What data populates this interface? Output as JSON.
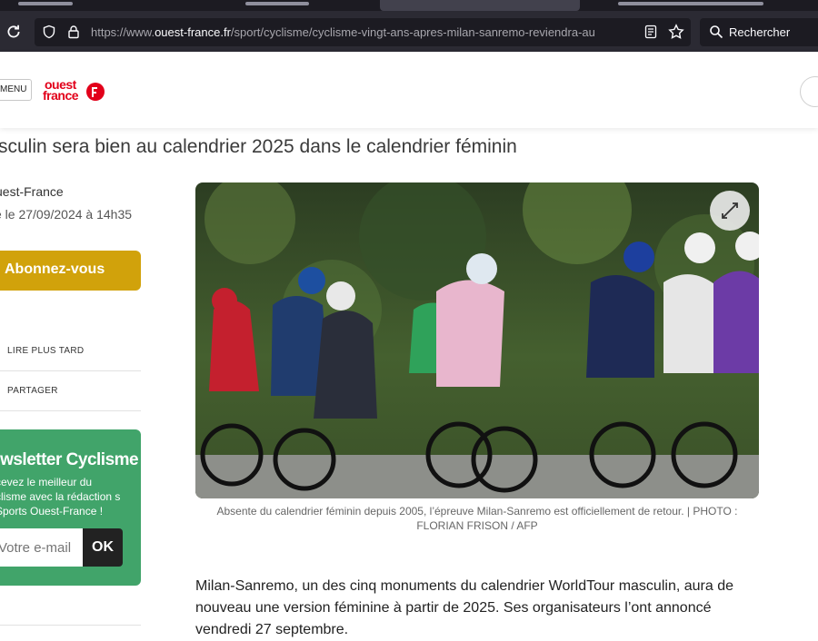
{
  "browser": {
    "url_prefix": "https://www.",
    "url_domain": "ouest-france.fr",
    "url_path": "/sport/cyclisme/cyclisme-vingt-ans-apres-milan-sanremo-reviendra-au",
    "search_placeholder": "Rechercher"
  },
  "site": {
    "menu_label": "MENU",
    "logo_line1": "ouest",
    "logo_line2": "france",
    "brand_color": "#e2001a"
  },
  "article": {
    "headline": "sculin sera bien au calendrier 2025 dans le calendrier féminin",
    "byline": "uest-France",
    "dateline": "é le 27/09/2024 à 14h35",
    "caption": "Absente du calendrier féminin depuis 2005, l’épreuve Milan-Sanremo est officiellement de retour. | PHOTO : FLORIAN FRISON / AFP",
    "body": "Milan-Sanremo, un des cinq monuments du calendrier WorldTour masculin, aura de nouveau une version féminine à partir de 2025. Ses organisateurs l’ont annoncé vendredi 27 septembre."
  },
  "sidebar": {
    "subscribe_label": "Abonnez-vous",
    "subscribe_color": "#d1a20b",
    "read_later_label": "LIRE PLUS TARD",
    "share_label": "PARTAGER"
  },
  "newsletter": {
    "title": "ewsletter Cyclisme",
    "text": "cevez le meilleur du clisme avec la rédaction s Sports Ouest-France !",
    "email_placeholder": "Votre e-mail",
    "submit_label": "OK",
    "color": "#41a46a"
  }
}
